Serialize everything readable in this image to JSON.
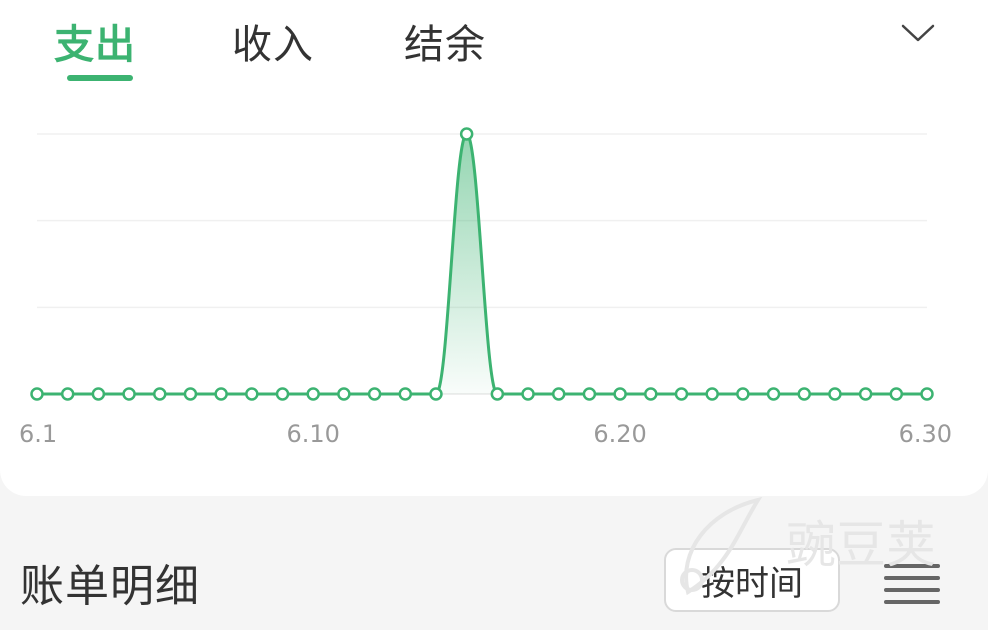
{
  "tabs": [
    {
      "label": "支出",
      "active": true
    },
    {
      "label": "收入",
      "active": false
    },
    {
      "label": "结余",
      "active": false
    }
  ],
  "icons": {
    "dropdown": "chevron-down-icon",
    "list": "list-icon"
  },
  "colors": {
    "accent": "#3cb371",
    "text": "#333333",
    "tick": "#999999",
    "grid": "#f0f0f0"
  },
  "chart_data": {
    "type": "area",
    "x": [
      "6.1",
      "6.2",
      "6.3",
      "6.4",
      "6.5",
      "6.6",
      "6.7",
      "6.8",
      "6.9",
      "6.10",
      "6.11",
      "6.12",
      "6.13",
      "6.14",
      "6.15",
      "6.16",
      "6.17",
      "6.18",
      "6.19",
      "6.20",
      "6.21",
      "6.22",
      "6.23",
      "6.24",
      "6.25",
      "6.26",
      "6.27",
      "6.28",
      "6.29",
      "6.30"
    ],
    "values": [
      0,
      0,
      0,
      0,
      0,
      0,
      0,
      0,
      0,
      0,
      0,
      0,
      0,
      0,
      1,
      0,
      0,
      0,
      0,
      0,
      0,
      0,
      0,
      0,
      0,
      0,
      0,
      0,
      0,
      0
    ],
    "tick_labels": [
      "6.1",
      "6.10",
      "6.20",
      "6.30"
    ],
    "grid": true,
    "gridline_count": 4
  },
  "bill_section": {
    "title": "账单明细",
    "sort_label": "按时间"
  },
  "watermark": {
    "text": "豌豆荚",
    "icon": "pea-pod-logo-icon"
  }
}
